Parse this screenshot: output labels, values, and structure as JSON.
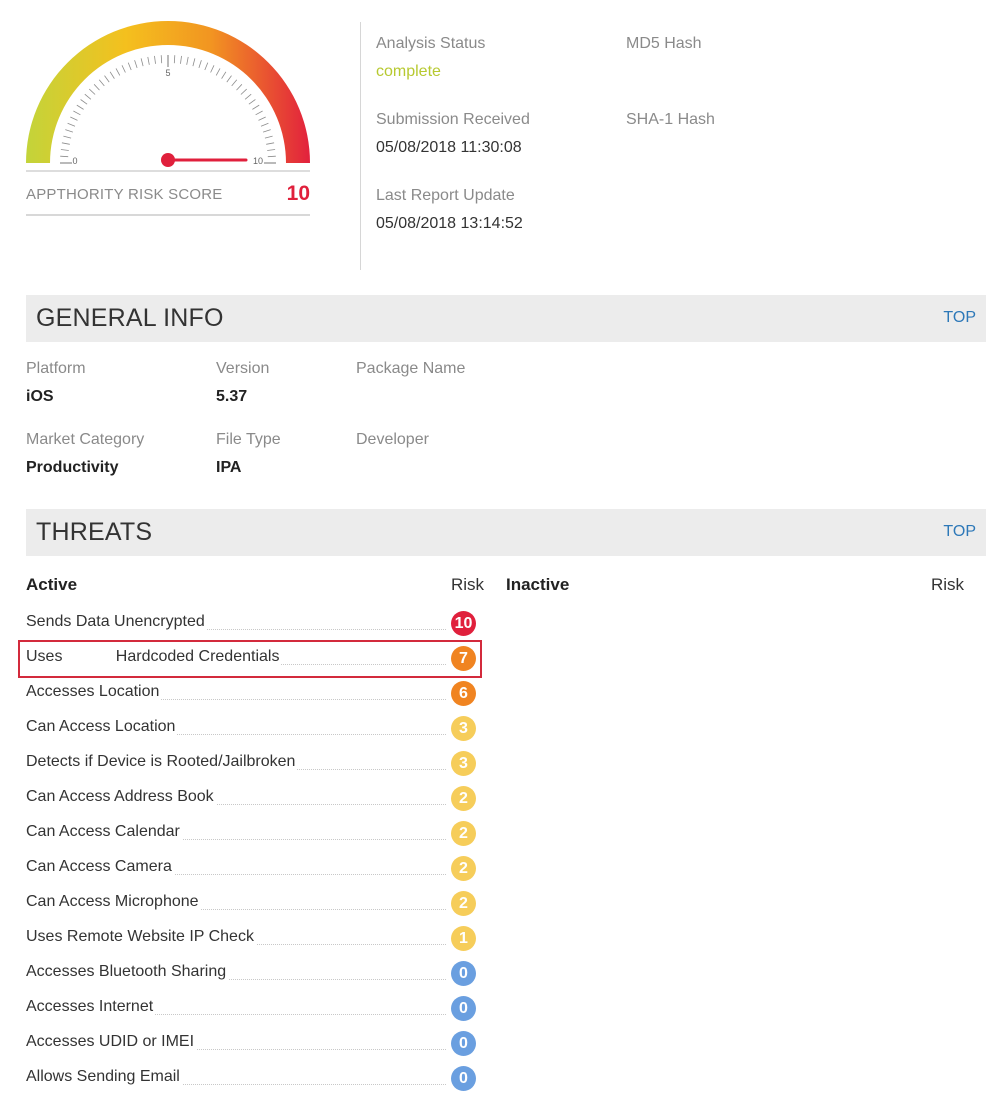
{
  "gauge": {
    "min_label": "0",
    "mid_label": "5",
    "max_label": "10",
    "score_fraction": 1.0,
    "colors": [
      "#c3d43a",
      "#f4c01e",
      "#f29521",
      "#e2213d"
    ]
  },
  "risk": {
    "label": "APPTHORITY RISK SCORE",
    "score": "10",
    "score_color": "#e0203c"
  },
  "meta": {
    "analysis_status_label": "Analysis Status",
    "analysis_status_value": "complete",
    "md5_label": "MD5 Hash",
    "submission_label": "Submission Received",
    "submission_value": "05/08/2018 11:30:08",
    "sha1_label": "SHA-1 Hash",
    "last_update_label": "Last Report Update",
    "last_update_value": "05/08/2018 13:14:52"
  },
  "general_info": {
    "title": "GENERAL INFO",
    "top_link": "TOP",
    "platform_label": "Platform",
    "platform_value": "iOS",
    "version_label": "Version",
    "version_value": "5.37",
    "package_label": "Package Name",
    "market_label": "Market Category",
    "market_value": "Productivity",
    "filetype_label": "File Type",
    "filetype_value": "IPA",
    "developer_label": "Developer"
  },
  "threats": {
    "title": "THREATS",
    "top_link": "TOP",
    "active_label": "Active",
    "risk_label": "Risk",
    "inactive_label": "Inactive",
    "inactive_risk_label": "Risk",
    "items": [
      {
        "name": "Sends Data Unencrypted",
        "risk": "10",
        "color": "#e0203c"
      },
      {
        "name": "Uses            Hardcoded Credentials",
        "risk": "7",
        "color": "#f08421"
      },
      {
        "name": "Accesses Location",
        "risk": "6",
        "color": "#f08421"
      },
      {
        "name": "Can Access Location",
        "risk": "3",
        "color": "#f6cd5a"
      },
      {
        "name": "Detects if Device is Rooted/Jailbroken",
        "risk": "3",
        "color": "#f6cd5a"
      },
      {
        "name": "Can Access Address Book",
        "risk": "2",
        "color": "#f6cd5a"
      },
      {
        "name": "Can Access Calendar",
        "risk": "2",
        "color": "#f6cd5a"
      },
      {
        "name": "Can Access Camera",
        "risk": "2",
        "color": "#f6cd5a"
      },
      {
        "name": "Can Access Microphone",
        "risk": "2",
        "color": "#f6cd5a"
      },
      {
        "name": "Uses Remote Website IP Check",
        "risk": "1",
        "color": "#f6cd5a"
      },
      {
        "name": "Accesses Bluetooth Sharing",
        "risk": "0",
        "color": "#6a9fe0"
      },
      {
        "name": "Accesses Internet",
        "risk": "0",
        "color": "#6a9fe0"
      },
      {
        "name": "Accesses UDID or IMEI",
        "risk": "0",
        "color": "#6a9fe0"
      },
      {
        "name": "Allows Sending Email",
        "risk": "0",
        "color": "#6a9fe0"
      }
    ]
  }
}
